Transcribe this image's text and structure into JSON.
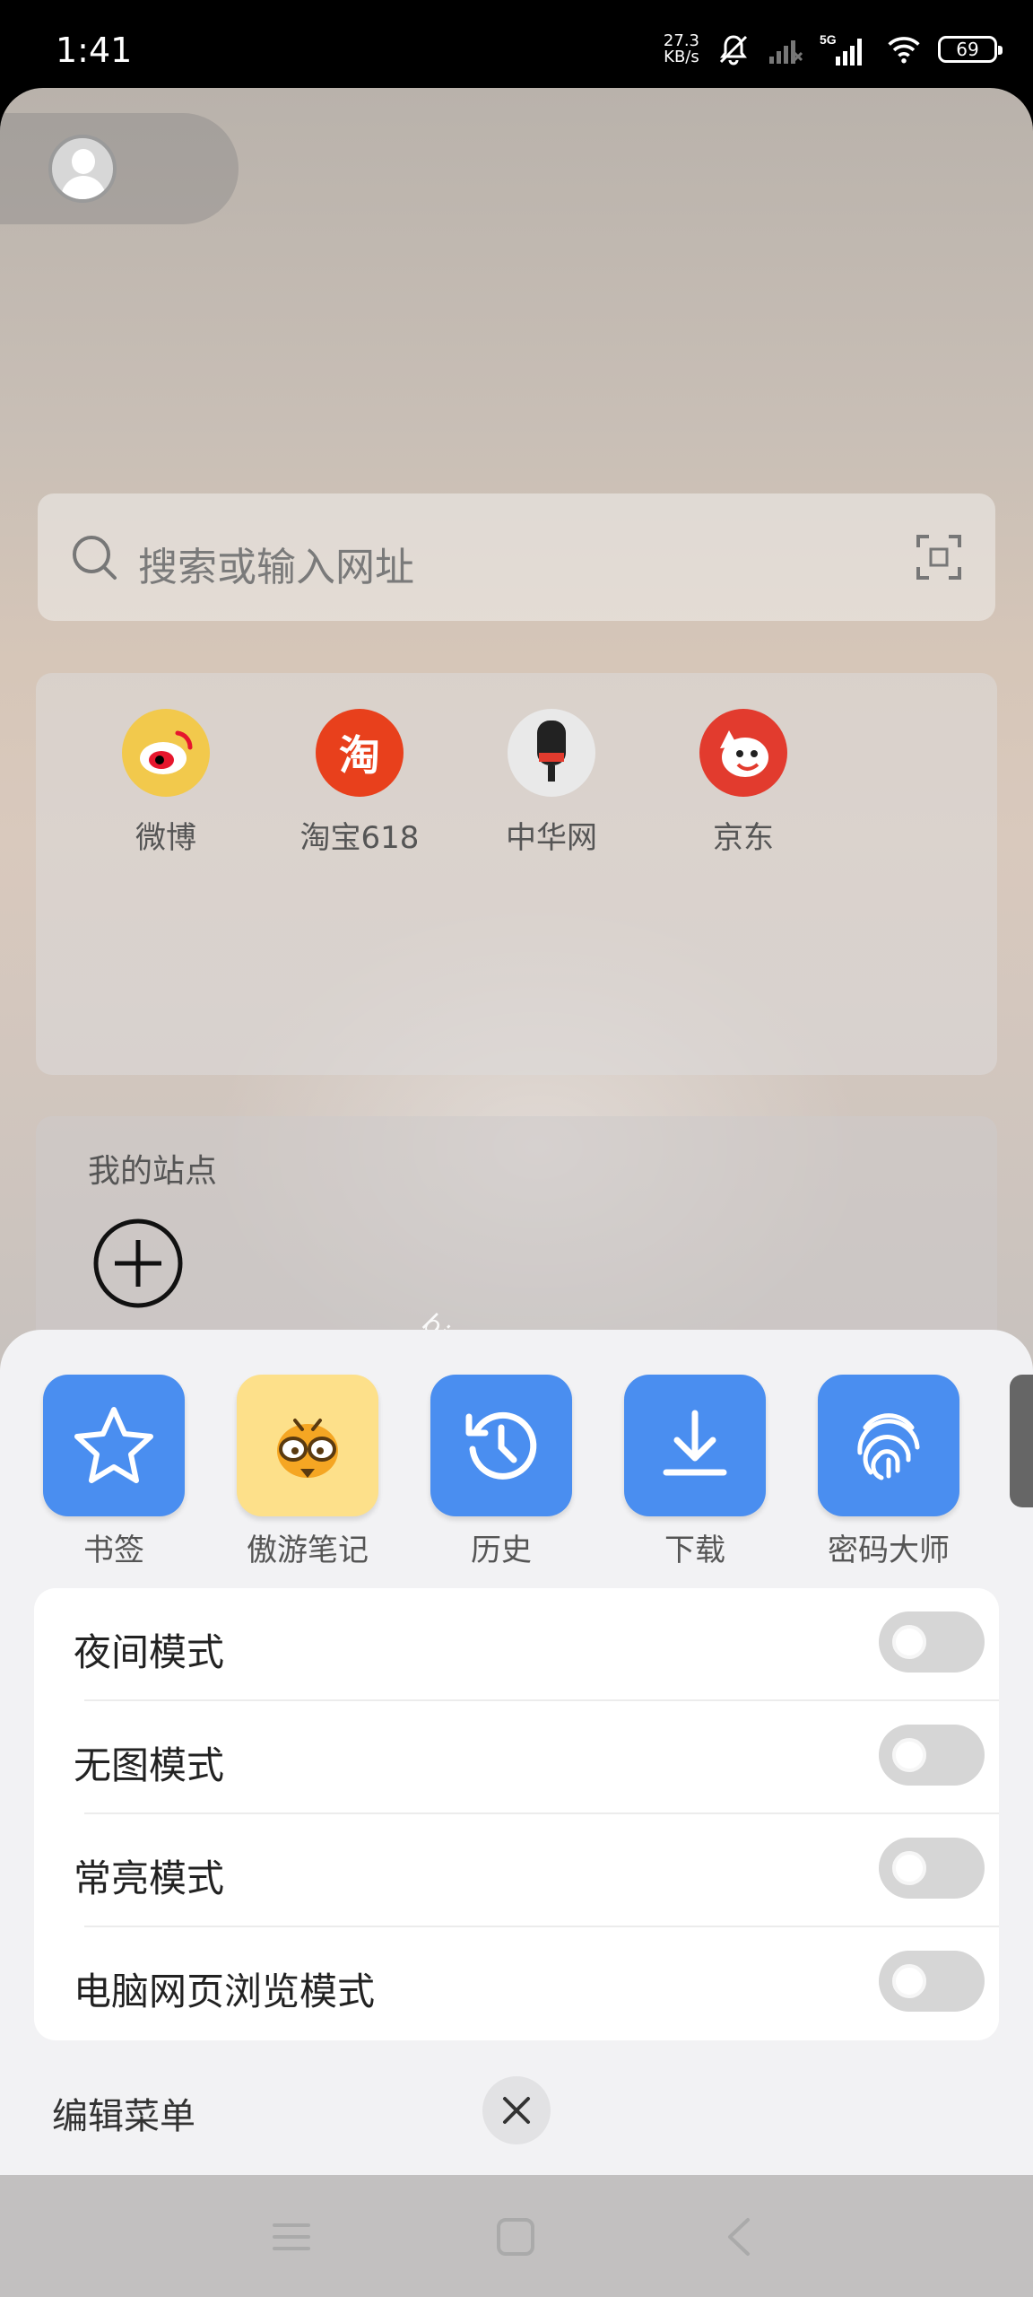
{
  "status_bar": {
    "time": "1:41",
    "net_speed_value": "27.3",
    "net_speed_unit": "KB/s",
    "network_type": "5G",
    "battery": "69"
  },
  "search": {
    "placeholder": "搜索或输入网址"
  },
  "quick_links": [
    {
      "label": "微博",
      "icon": "weibo-icon",
      "color": "#f2c94c"
    },
    {
      "label": "淘宝618",
      "icon": "taobao-icon",
      "color": "#e8401c",
      "glyph": "淘"
    },
    {
      "label": "中华网",
      "icon": "china-com-icon",
      "color": "#e9e9e9"
    },
    {
      "label": "京东",
      "icon": "jd-icon",
      "color": "#e23b2e"
    }
  ],
  "my_sites": {
    "title": "我的站点"
  },
  "watermark": "bianzy.top",
  "tools": [
    {
      "label": "书签",
      "icon": "star-icon",
      "color": "#4a8ef0"
    },
    {
      "label": "傲游笔记",
      "icon": "bee-icon",
      "color": "#fde08a"
    },
    {
      "label": "历史",
      "icon": "history-icon",
      "color": "#4a8ef0"
    },
    {
      "label": "下载",
      "icon": "download-icon",
      "color": "#4a8ef0"
    },
    {
      "label": "密码大师",
      "icon": "fingerprint-icon",
      "color": "#4a8ef0"
    }
  ],
  "settings": [
    {
      "label": "夜间模式",
      "enabled": false
    },
    {
      "label": "无图模式",
      "enabled": false
    },
    {
      "label": "常亮模式",
      "enabled": false
    },
    {
      "label": "电脑网页浏览模式",
      "enabled": false
    }
  ],
  "footer": {
    "edit_menu_label": "编辑菜单"
  }
}
